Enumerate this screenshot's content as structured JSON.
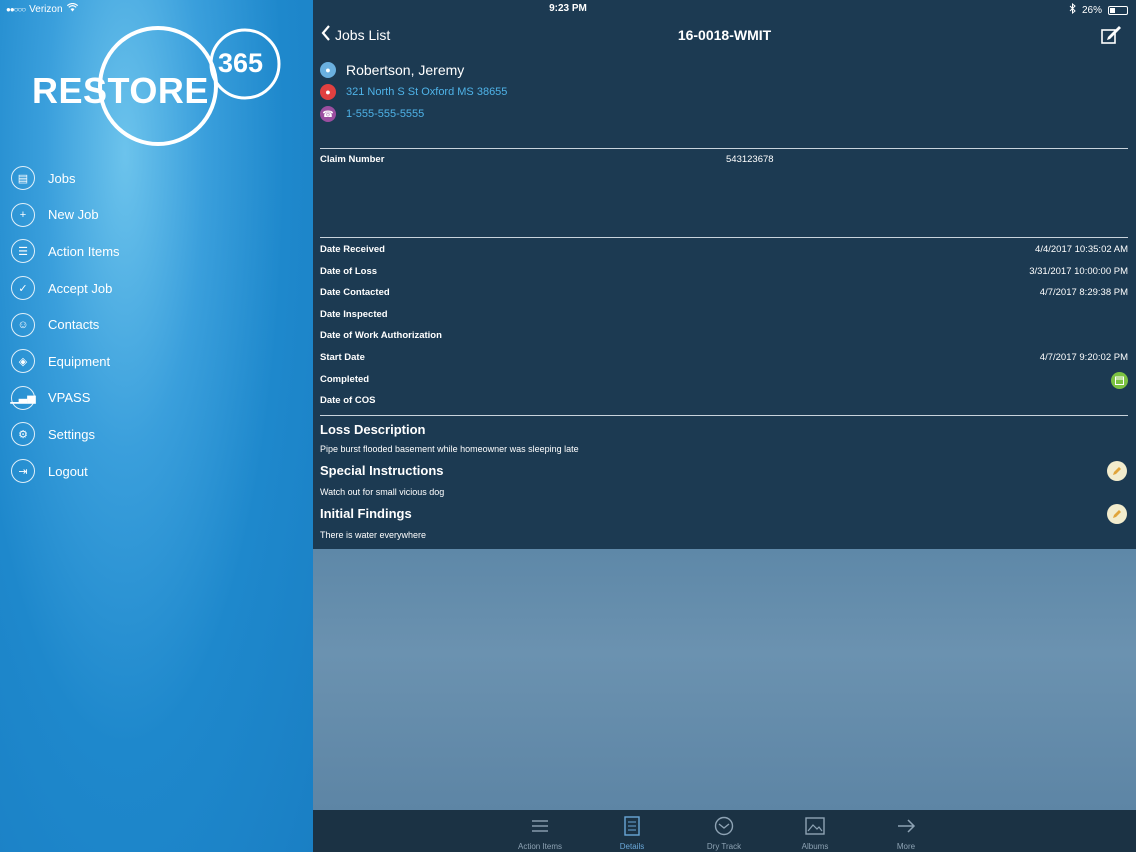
{
  "status_bar": {
    "carrier": "Verizon",
    "time": "9:23 PM",
    "battery": "26%"
  },
  "brand": {
    "name": "RESTORE",
    "number": "365"
  },
  "sidebar": {
    "items": [
      {
        "label": "Jobs",
        "icon": "jobs-icon"
      },
      {
        "label": "New Job",
        "icon": "new-job-icon"
      },
      {
        "label": "Action Items",
        "icon": "list-icon"
      },
      {
        "label": "Accept Job",
        "icon": "accept-job-icon"
      },
      {
        "label": "Contacts",
        "icon": "contacts-icon"
      },
      {
        "label": "Equipment",
        "icon": "equipment-icon"
      },
      {
        "label": "VPASS",
        "icon": "signal-icon"
      },
      {
        "label": "Settings",
        "icon": "gear-icon"
      },
      {
        "label": "Logout",
        "icon": "logout-icon"
      }
    ]
  },
  "navbar": {
    "back_label": "Jobs List",
    "title": "16-0018-WMIT"
  },
  "contact": {
    "name": "Robertson, Jeremy",
    "address": "321 North S St  Oxford MS 38655",
    "phone": "1-555-555-5555"
  },
  "claim": {
    "label": "Claim Number",
    "value": "543123678"
  },
  "dates": [
    {
      "label": "Date Received",
      "value": "4/4/2017 10:35:02 AM"
    },
    {
      "label": "Date of Loss",
      "value": "3/31/2017 10:00:00 PM"
    },
    {
      "label": "Date Contacted",
      "value": "4/7/2017 8:29:38 PM"
    },
    {
      "label": "Date Inspected",
      "value": ""
    },
    {
      "label": "Date of Work Authorization",
      "value": ""
    },
    {
      "label": "Start Date",
      "value": "4/7/2017 9:20:02 PM"
    },
    {
      "label": "Completed",
      "value": ""
    },
    {
      "label": "Date of COS",
      "value": ""
    }
  ],
  "sections": [
    {
      "title": "Loss Description",
      "text": "Pipe burst flooded basement while homeowner was sleeping late"
    },
    {
      "title": "Special Instructions",
      "text": "Watch out for small vicious dog"
    },
    {
      "title": "Initial Findings",
      "text": "There is water everywhere"
    }
  ],
  "tabs": [
    {
      "label": "Action Items",
      "icon": "list-icon"
    },
    {
      "label": "Details",
      "icon": "document-icon",
      "active": true
    },
    {
      "label": "Dry Track",
      "icon": "dry-track-icon"
    },
    {
      "label": "Albums",
      "icon": "image-icon"
    },
    {
      "label": "More",
      "icon": "arrow-right-icon"
    }
  ],
  "colors": {
    "sidebar": "#1e88cc",
    "panel": "#1c3a52",
    "link": "#4fb3e8",
    "tab_active": "#6aa7d8"
  }
}
